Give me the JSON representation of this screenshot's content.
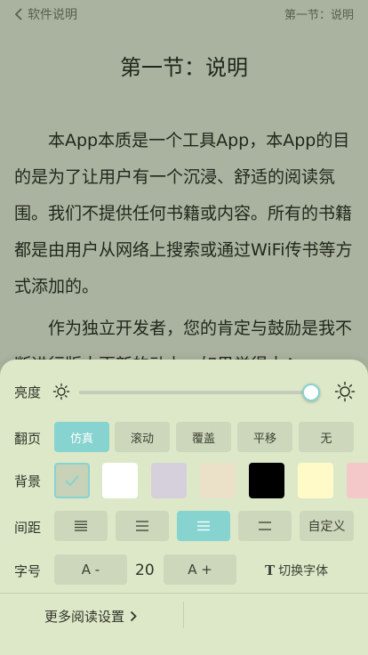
{
  "topbar": {
    "back_label": "软件说明",
    "chapter_right": "第一节：说明"
  },
  "reader": {
    "chapter_title": "第一节：说明",
    "paragraphs": [
      "本App本质是一个工具App，本App的目的是为了让用户有一个沉浸、舒适的阅读氛围。我们不提供任何书籍或内容。所有的书籍都是由用户从网络上搜索或通过WiFi传书等方式添加的。",
      "作为独立开发者，您的肯定与鼓励是我不断进行版本更新的动力，如果觉得本App"
    ]
  },
  "settings": {
    "brightness": {
      "label": "亮度",
      "level": 0.96
    },
    "page_turn": {
      "label": "翻页",
      "options": [
        "仿真",
        "滚动",
        "覆盖",
        "平移",
        "无"
      ],
      "selected": 0
    },
    "background": {
      "label": "背景",
      "swatches": [
        "#c8d2b8",
        "#ffffff",
        "#d6cfdc",
        "#ebe1c8",
        "#000000",
        "#fffac8",
        "#f4c8c8"
      ],
      "selected": 0
    },
    "spacing": {
      "label": "间距",
      "options": [
        "dense",
        "compact",
        "normal",
        "loose"
      ],
      "custom_label": "自定义",
      "selected": 2
    },
    "font_size": {
      "label": "字号",
      "decrease_label": "A -",
      "value": "20",
      "increase_label": "A +",
      "switch_font_label": "切换字体"
    },
    "more_label": "更多阅读设置"
  },
  "colors": {
    "accent": "#86d3cf",
    "panel": "#dde8c8"
  }
}
